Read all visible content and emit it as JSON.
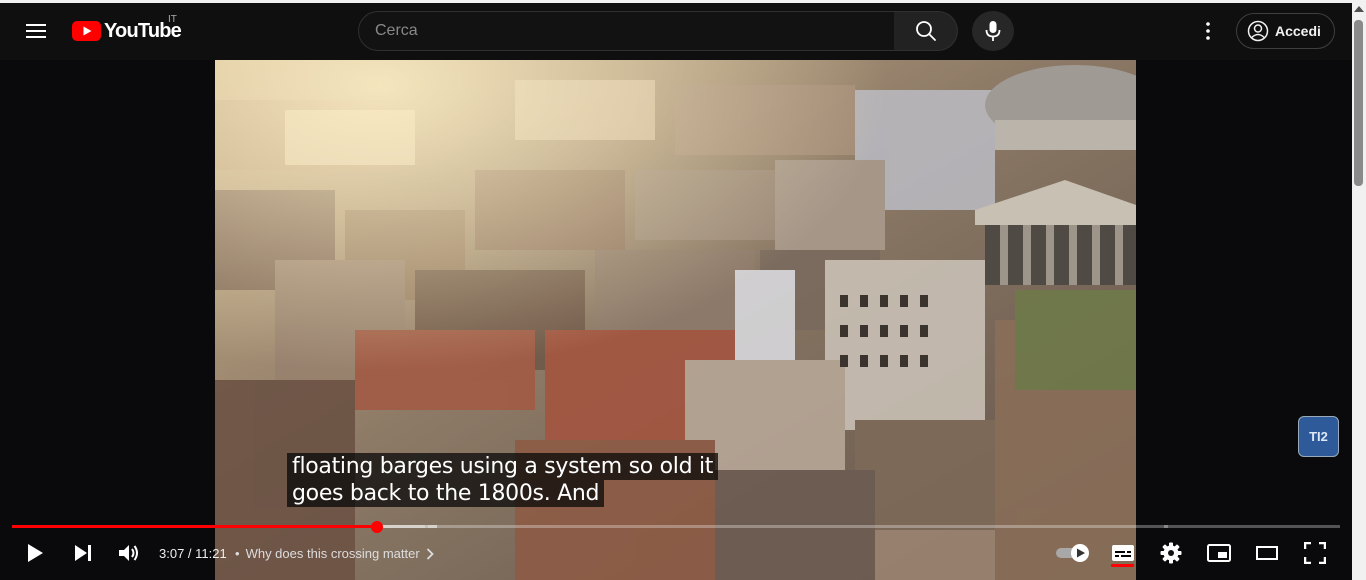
{
  "masthead": {
    "logo_text": "YouTube",
    "country_code": "IT",
    "search_placeholder": "Cerca",
    "signin_label": "Accedi"
  },
  "video": {
    "caption_lines": [
      "floating barges using a system so old it",
      "goes back to the 1800s. And"
    ],
    "watermark_text": "TI2"
  },
  "controls": {
    "time_display": "3:07 / 11:21",
    "chapter_separator": "•",
    "chapter_title": "Why does this crossing matter",
    "progress_fraction": 0.275,
    "buffered_fraction": 0.32,
    "subtitles_on": true
  },
  "icons": {
    "menu": "hamburger-icon",
    "search": "search-icon",
    "mic": "microphone-icon",
    "more": "more-vertical-icon",
    "account": "account-circle-icon",
    "play": "play-icon",
    "next": "skip-next-icon",
    "volume": "volume-icon",
    "autoplay": "autoplay-toggle-icon",
    "subtitles": "subtitles-icon",
    "settings": "gear-icon",
    "miniplayer": "miniplayer-icon",
    "theater": "theater-mode-icon",
    "fullscreen": "fullscreen-icon"
  },
  "colors": {
    "brand_red": "#ff0000",
    "background": "#0f0f0f"
  }
}
